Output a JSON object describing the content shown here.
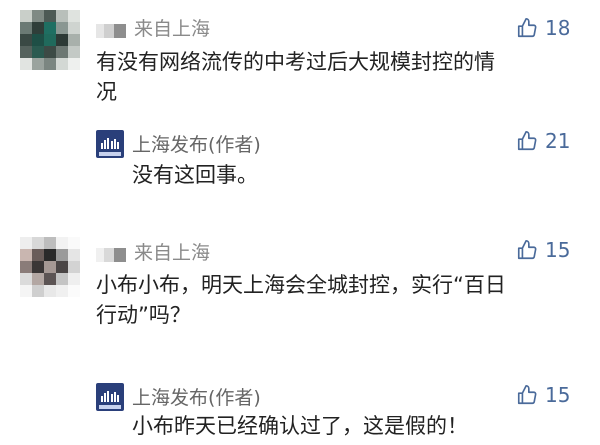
{
  "comments": [
    {
      "location": "来自上海",
      "likes": "18",
      "text_lines": [
        "有没有网络流传的中考过后大规模封控的情",
        "况"
      ]
    },
    {
      "author": "上海发布(作者)",
      "likes": "21",
      "text_lines": [
        "没有这回事。"
      ]
    },
    {
      "location": "来自上海",
      "likes": "15",
      "text_lines": [
        "小布小布，明天上海会全城封控，实行“百日",
        "行动”吗？"
      ]
    },
    {
      "author": "上海发布(作者)",
      "likes": "15",
      "text_lines": [
        "小布昨天已经确认过了，这是假的！"
      ]
    }
  ],
  "icons": {
    "like": "thumbs-up-icon",
    "official_avatar": "shanghai-fabu-logo"
  },
  "colors": {
    "meta_text": "#8a8a8a",
    "body_text": "#222222",
    "like_count": "#4a6a9a",
    "official_logo": "#2a3f7a"
  }
}
